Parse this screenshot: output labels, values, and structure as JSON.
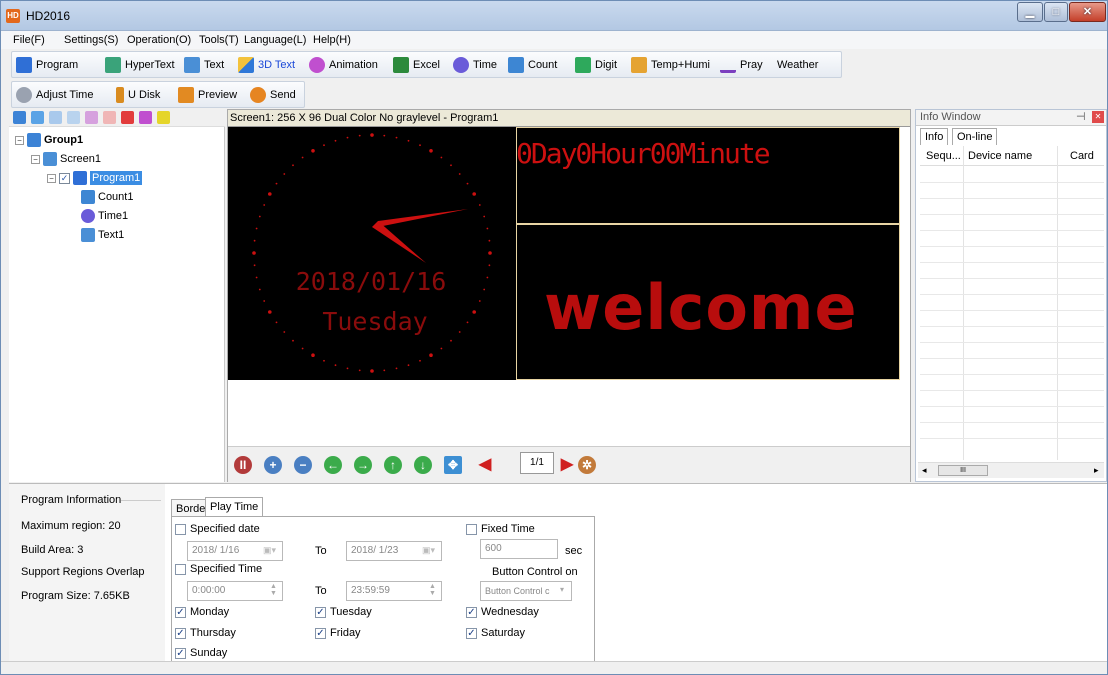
{
  "window": {
    "title": "HD2016",
    "app_icon_text": "HD",
    "min": "▁",
    "max": "□",
    "close": "✕"
  },
  "menu": [
    "File(F)",
    "Settings(S)",
    "Operation(O)",
    "Tools(T)",
    "Language(L)",
    "Help(H)"
  ],
  "toolbar1": [
    {
      "label": "Program",
      "icon": "program-icon",
      "color": "#2f6fd6"
    },
    {
      "label": "HyperText",
      "icon": "hypertext-icon",
      "color": "#3aa37a"
    },
    {
      "label": "Text",
      "icon": "text-icon",
      "color": "#4a8fd6"
    },
    {
      "label": "3D Text",
      "icon": "3d-text-icon",
      "color": "#e0a020"
    },
    {
      "label": "Animation",
      "icon": "animation-icon",
      "color": "#c04fcf"
    },
    {
      "label": "Excel",
      "icon": "excel-icon",
      "color": "#2c8a3c"
    },
    {
      "label": "Time",
      "icon": "clock-icon",
      "color": "#6a5bd9"
    },
    {
      "label": "Count",
      "icon": "count-icon",
      "color": "#3d86d3"
    },
    {
      "label": "Digit",
      "icon": "digit-icon",
      "color": "#2ea95c"
    },
    {
      "label": "Temp+Humi",
      "icon": "thermometer-icon",
      "color": "#e5a332"
    },
    {
      "label": "Pray",
      "icon": "pray-icon",
      "color": "#7b3fbf"
    },
    {
      "label": "Weather",
      "icon": "",
      "color": ""
    }
  ],
  "toolbar2": [
    {
      "label": "Adjust Time",
      "icon": "adjust-time-icon",
      "color": "#9aa2b0"
    },
    {
      "label": "U Disk",
      "icon": "usb-disk-icon",
      "color": "#d98b1f"
    },
    {
      "label": "Preview",
      "icon": "camera-icon",
      "color": "#e28a22"
    },
    {
      "label": "Send",
      "icon": "send-icon",
      "color": "#e68521"
    }
  ],
  "tree": {
    "group": "Group1",
    "screen": "Screen1",
    "program": "Program1",
    "items": [
      "Count1",
      "Time1",
      "Text1"
    ]
  },
  "screen_header": "Screen1: 256 X 96  Dual Color No graylevel - Program1",
  "led": {
    "clock_date": "2018/01/16",
    "clock_day": "Tuesday",
    "count_text": "0Day0Hour00Minute",
    "text_content": "welcome",
    "color": "#cc1010"
  },
  "playbar": {
    "page": "1/1"
  },
  "info": {
    "title": "Info Window",
    "tabs": [
      "Info",
      "On-line"
    ],
    "columns": [
      "Sequ...",
      "Device name",
      "Card"
    ],
    "pin": "⊣",
    "close": "✕",
    "scroll_grip": "III"
  },
  "program_info": {
    "header": "Program Information",
    "max_region": "Maximum region: 20",
    "build_area": "Build Area: 3",
    "overlap": "Support Regions Overlap",
    "size": "Program Size: 7.65KB"
  },
  "tabs": [
    "Border",
    "Play Time"
  ],
  "play_time": {
    "specified_date": "Specified date",
    "date_from": "2018/ 1/16",
    "to1": "To",
    "date_to": "2018/ 1/23",
    "specified_time": "Specified Time",
    "time_from": "0:00:00",
    "to2": "To",
    "time_to": "23:59:59",
    "fixed_time": "Fixed Time",
    "fixed_value": "600",
    "sec": "sec",
    "button_control_label": "Button Control on",
    "button_control_value": "Button Control c",
    "days": [
      "Monday",
      "Tuesday",
      "Wednesday",
      "Thursday",
      "Friday",
      "Saturday",
      "Sunday"
    ]
  }
}
